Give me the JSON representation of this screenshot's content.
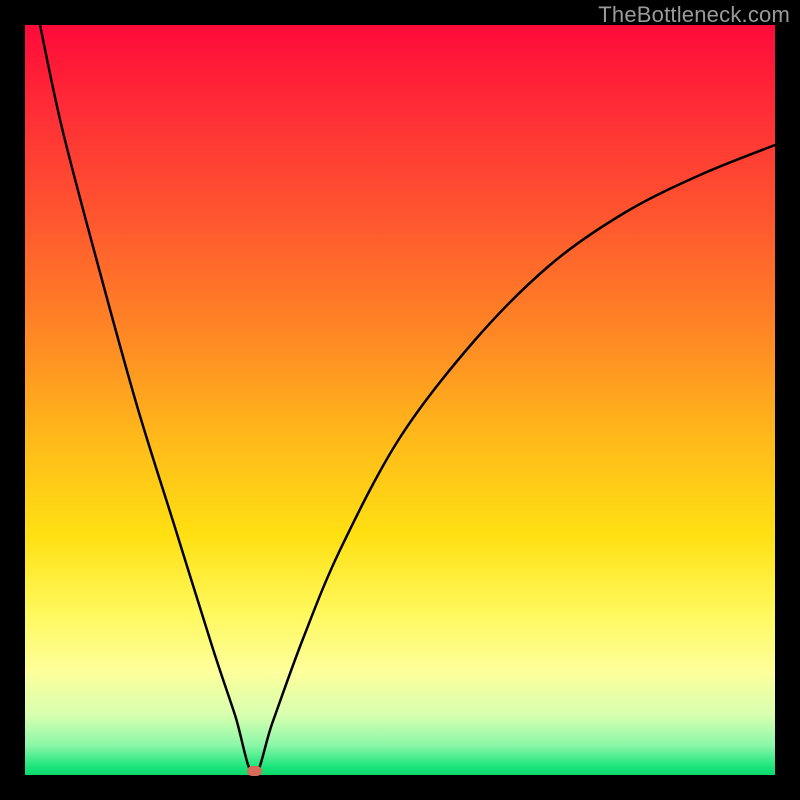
{
  "watermark": "TheBottleneck.com",
  "colors": {
    "frame": "#000000",
    "curve": "#000000",
    "marker": "#d66b5a",
    "gradient_top": "#ff0a3a",
    "gradient_bottom": "#0ed86c"
  },
  "marker": {
    "x_frac": 0.305,
    "y_frac": 0.996
  },
  "chart_data": {
    "type": "line",
    "title": "",
    "xlabel": "",
    "ylabel": "",
    "xlim": [
      0,
      1
    ],
    "ylim": [
      0,
      100
    ],
    "note": "Axes are unlabeled in the source image; y appears to be a bottleneck percentage (100% at top in red, 0% at bottom in green) and x is an unspecified normalized parameter. A V-shaped curve reaches ~0 at x≈0.31 where a small marker sits.",
    "series": [
      {
        "name": "bottleneck_curve",
        "x": [
          0.02,
          0.05,
          0.1,
          0.15,
          0.2,
          0.25,
          0.28,
          0.305,
          0.33,
          0.37,
          0.42,
          0.5,
          0.6,
          0.7,
          0.8,
          0.9,
          1.0
        ],
        "values": [
          100,
          86,
          67,
          49,
          33,
          17,
          8,
          0,
          7,
          18,
          30,
          45,
          58,
          68,
          75,
          80,
          84
        ]
      }
    ],
    "marker_point": {
      "x": 0.305,
      "y": 0
    }
  }
}
